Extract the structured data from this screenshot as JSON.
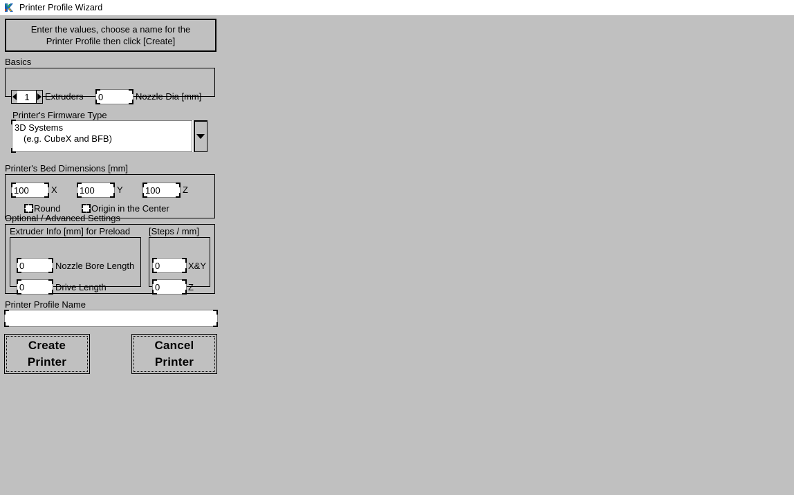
{
  "window": {
    "title": "Printer Profile Wizard",
    "icon": "app-icon"
  },
  "instruction": {
    "line1": "Enter the values, choose a name for the",
    "line2": "Printer Profile then click [Create]"
  },
  "basics": {
    "group_label": "Basics",
    "extruders": {
      "value": "1",
      "label": "Extruders",
      "decrement_icon": "triangle-left-icon",
      "increment_icon": "triangle-right-icon"
    },
    "nozzle_dia": {
      "value": "0",
      "label": "Nozzle Dia [mm]"
    },
    "firmware": {
      "label": "Printer's Firmware Type",
      "selected_line1": "3D Systems",
      "selected_line2": "(e.g. CubeX and BFB)",
      "arrow_icon": "chevron-down-icon"
    }
  },
  "bed": {
    "group_label": "Printer's Bed Dimensions [mm]",
    "x": {
      "value": "100",
      "label": "X"
    },
    "y": {
      "value": "100",
      "label": "Y"
    },
    "z": {
      "value": "100",
      "label": "Z"
    },
    "round": {
      "label": "Round",
      "checked": false
    },
    "origin_center": {
      "label": "Origin in the Center",
      "checked": false
    }
  },
  "advanced": {
    "group_label": "Optional / Advanced Settings",
    "extruder_info": {
      "group_label": "Extruder Info [mm] for Preload",
      "nozzle_bore_length": {
        "value": "0",
        "label": "Nozzle Bore Length"
      },
      "drive_length": {
        "value": "0",
        "label": "Drive Length"
      }
    },
    "steps": {
      "group_label": "[Steps / mm]",
      "xy": {
        "value": "0",
        "label": "X&Y"
      },
      "z": {
        "value": "0",
        "label": "Z"
      }
    }
  },
  "profile_name": {
    "label": "Printer Profile Name",
    "value": "",
    "placeholder": ""
  },
  "buttons": {
    "create": {
      "line1": "Create",
      "line2": "Printer"
    },
    "cancel": {
      "line1": "Cancel",
      "line2": "Printer"
    }
  },
  "colors": {
    "window_background": "#c0c0c0",
    "titlebar_background": "#ffffff",
    "field_background": "#ffffff",
    "border": "#000000",
    "text": "#000000"
  }
}
